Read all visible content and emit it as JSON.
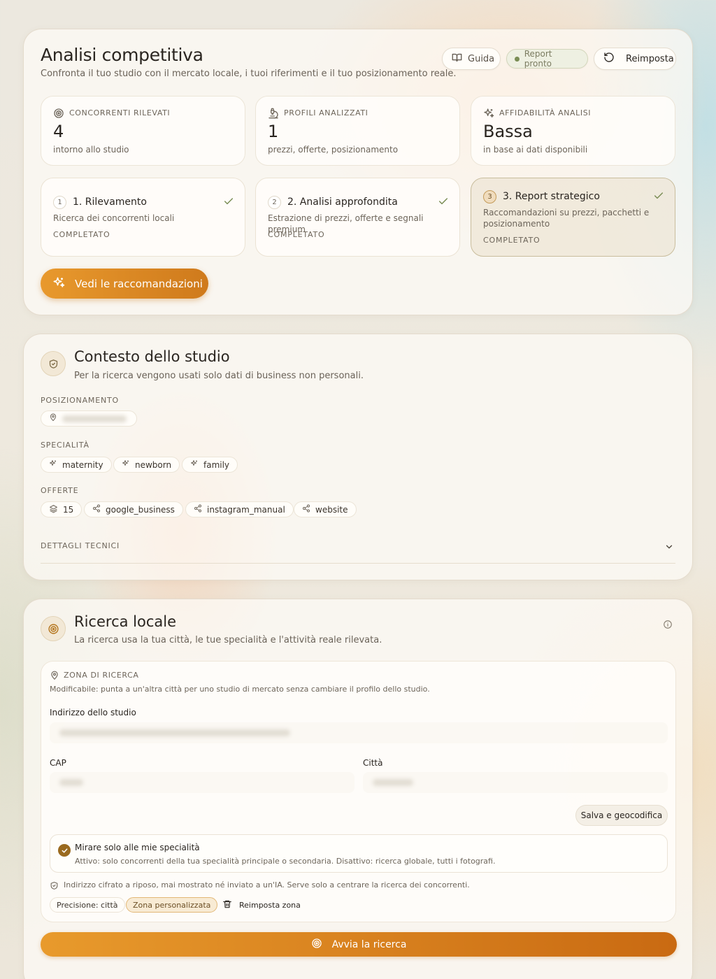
{
  "header": {
    "title": "Analisi competitiva",
    "subtitle": "Confronta il tuo studio con il mercato locale, i tuoi riferimenti e il tuo posizionamento reale.",
    "guide_label": "Guida",
    "status_badge": "Report pronto",
    "reset_label": "Reimposta"
  },
  "stats": [
    {
      "label": "CONCORRENTI RILEVATI",
      "value": "4",
      "caption": "intorno allo studio",
      "icon": "radar-icon"
    },
    {
      "label": "PROFILI ANALIZZATI",
      "value": "1",
      "caption": "prezzi, offerte, posizionamento",
      "icon": "microscope-icon"
    },
    {
      "label": "AFFIDABILITÀ ANALISI",
      "value": "Bassa",
      "caption": "in base ai dati disponibili",
      "icon": "sparkles-icon"
    }
  ],
  "steps": [
    {
      "num": "1",
      "title": "1. Rilevamento",
      "desc": "Ricerca dei concorrenti locali",
      "status": "COMPLETATO"
    },
    {
      "num": "2",
      "title": "2. Analisi approfondita",
      "desc": "Estrazione di prezzi, offerte e segnali premium",
      "status": "COMPLETATO"
    },
    {
      "num": "3",
      "title": "3. Report strategico",
      "desc": "Raccomandazioni su prezzi, pacchetti e posizionamento",
      "status": "COMPLETATO"
    }
  ],
  "recommend_button": "Vedi le raccomandazioni",
  "context": {
    "title": "Contesto dello studio",
    "subtitle": "Per la ricerca vengono usati solo dati di business non personali.",
    "positioning_label": "POSIZIONAMENTO",
    "specialties_label": "SPECIALITÀ",
    "specialties": [
      "maternity",
      "newborn",
      "family"
    ],
    "offers_label": "OFFERTE",
    "offers_count": "15",
    "offers": [
      "google_business",
      "instagram_manual",
      "website"
    ],
    "tech_details_label": "DETTAGLI TECNICI"
  },
  "local": {
    "title": "Ricerca locale",
    "subtitle": "La ricerca usa la tua città, le tue specialità e l'attività reale rilevata.",
    "zone_label": "ZONA DI RICERCA",
    "zone_desc": "Modificabile: punta a un'altra città per uno studio di mercato senza cambiare il profilo dello studio.",
    "address_label": "Indirizzo dello studio",
    "cap_label": "CAP",
    "city_label": "Città",
    "geocode_button": "Salva e geocodifica",
    "toggle_title": "Mirare solo alle mie specialità",
    "toggle_desc": "Attivo: solo concorrenti della tua specialità principale o secondaria. Disattivo: ricerca globale, tutti i fotografi.",
    "privacy_note": "Indirizzo cifrato a riposo, mai mostrato né inviato a un'IA. Serve solo a centrare la ricerca dei concorrenti.",
    "precision_pill": "Precisione: città",
    "custom_zone_pill": "Zona personalizzata",
    "reset_zone": "Reimposta zona",
    "start_button": "Avvia la ricerca"
  }
}
